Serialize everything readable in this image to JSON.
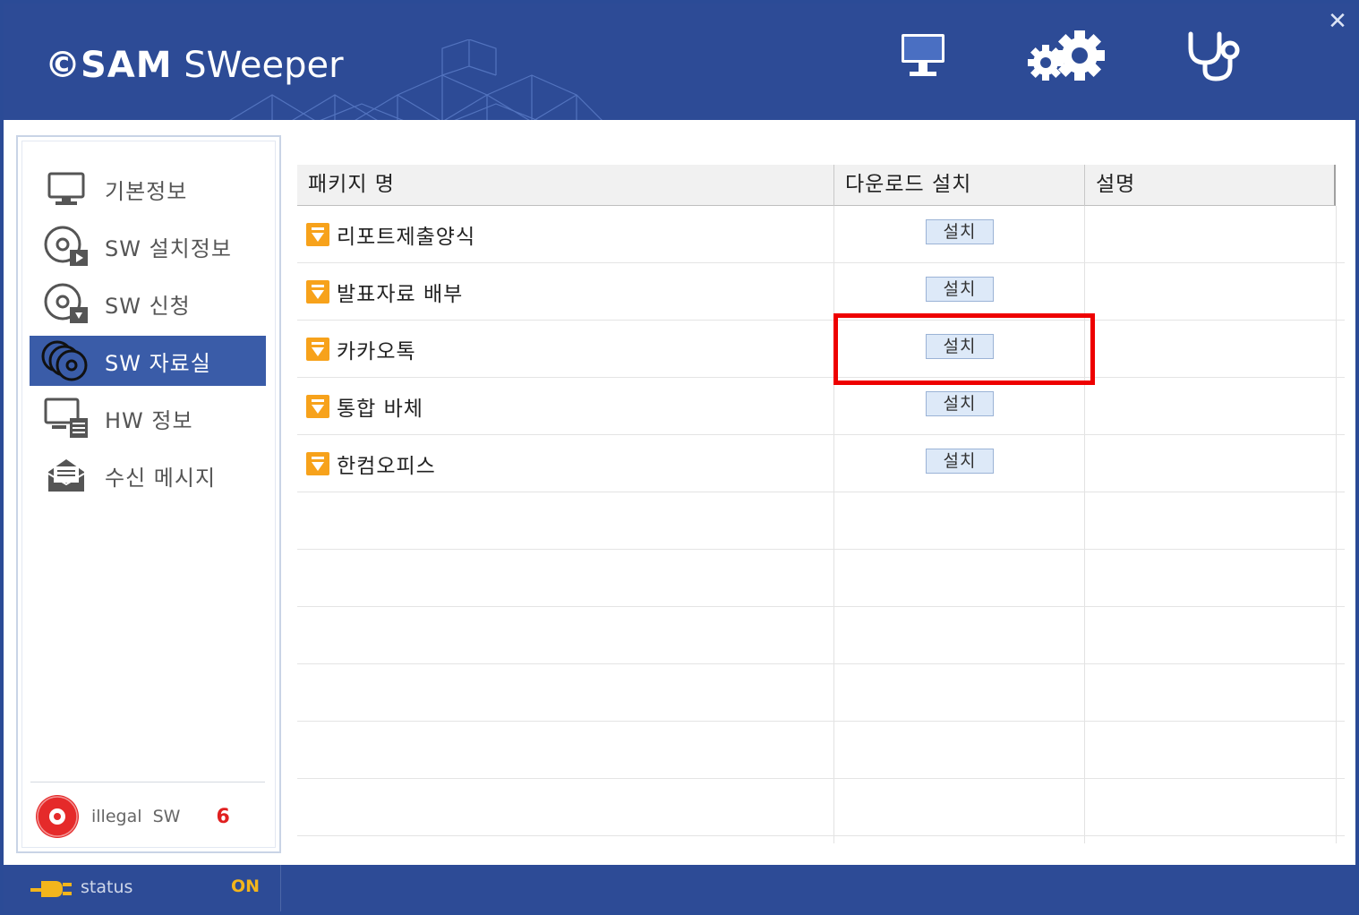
{
  "app": {
    "logo_c": "©",
    "logo_sam": "SAM",
    "logo_sweeper": " SWeeper",
    "close": "✕"
  },
  "header_icons": [
    "monitor-icon",
    "gears-icon",
    "stethoscope-icon"
  ],
  "sidebar": {
    "items": [
      {
        "label": "기본정보",
        "icon": "monitor-icon",
        "active": false
      },
      {
        "label": "SW 설치정보",
        "icon": "disc-play-icon",
        "active": false
      },
      {
        "label": "SW 신청",
        "icon": "disc-download-icon",
        "active": false
      },
      {
        "label": "SW 자료실",
        "icon": "discs-stack-icon",
        "active": true
      },
      {
        "label": "HW 정보",
        "icon": "hw-monitor-icon",
        "active": false
      },
      {
        "label": "수신 메시지",
        "icon": "envelope-icon",
        "active": false
      }
    ],
    "illegal": {
      "label": "illegal  SW",
      "count": "6"
    }
  },
  "table": {
    "headers": [
      "패키지 명",
      "다운로드 설치",
      "설명"
    ],
    "rows": [
      {
        "name": "리포트제출양식",
        "button": "설치",
        "desc": ""
      },
      {
        "name": "발표자료 배부",
        "button": "설치",
        "desc": ""
      },
      {
        "name": "카카오톡",
        "button": "설치",
        "desc": ""
      },
      {
        "name": "통합 바체",
        "button": "설치",
        "desc": ""
      },
      {
        "name": "한컴오피스",
        "button": "설치",
        "desc": ""
      }
    ]
  },
  "status": {
    "label": "status",
    "value": "ON"
  },
  "colors": {
    "brand": "#2d4b96",
    "active": "#3a5ca8",
    "accent": "#f3b51c",
    "highlight": "#ee0000"
  }
}
